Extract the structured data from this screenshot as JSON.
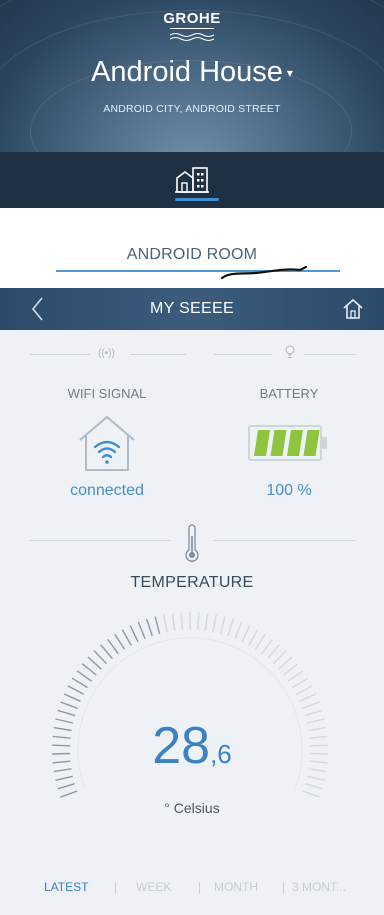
{
  "header": {
    "brand": "GROHE",
    "house_name": "Android House",
    "caret": "▾",
    "address": "ANDROID CITY, ANDROID STREET",
    "background_color": "#2c4660"
  },
  "tabs": {
    "active_icon": "building-icon",
    "indicator_color": "#3f8fd0"
  },
  "room": {
    "name": "ANDROID ROOM"
  },
  "device": {
    "back_icon": "chevron-left-icon",
    "title": "MY SEEEE",
    "home_icon": "home-icon"
  },
  "wifi": {
    "label": "WIFI SIGNAL",
    "status": "connected",
    "icon": "wifi-house-icon"
  },
  "battery": {
    "label": "BATTERY",
    "value": "100 %",
    "level": 1.0,
    "fill_color": "#8cc63f"
  },
  "temperature": {
    "label": "TEMPERATURE",
    "integer": "28",
    "decimal": ",6",
    "unit": "° Celsius",
    "accent_color": "#3a82c2"
  },
  "range_tabs": {
    "latest": "LATEST",
    "sep1": "|",
    "week": "WEEK",
    "sep2": "|",
    "month": "MONTH",
    "sep3": "|",
    "three_month": "3 MONT..."
  }
}
